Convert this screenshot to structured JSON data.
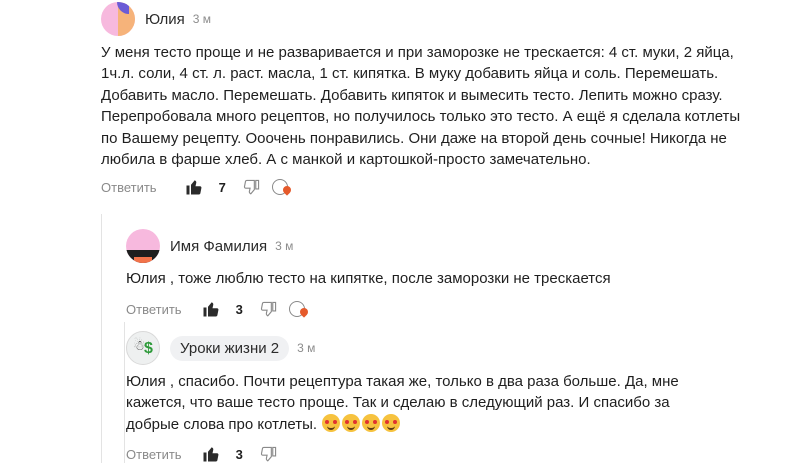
{
  "comments": [
    {
      "author": "Юлия",
      "time": "3 м",
      "text": "У меня тесто проще и не разваривается и при заморозке не трескается: 4 ст. муки, 2 яйца, 1ч.л. соли, 4 ст. л. раст. масла, 1 ст. кипятка. В муку добавить яйца и соль. Перемешать. Добавить масло. Перемешать. Добавить кипяток и вымесить тесто. Лепить можно сразу. Перепробовала много рецептов, но получилось только это тесто. А ещё я сделала котлеты по Вашему рецепту. Ооочень понравились. Они даже на второй день сочные! Никогда не любила в фарше хлеб. А с манкой и картошкой-просто замечательно.",
      "reply_label": "Ответить",
      "likes": "7"
    },
    {
      "author": "Имя Фамилия",
      "time": "3 м",
      "text": "Юлия , тоже люблю тесто на кипятке, после заморозки не трескается",
      "reply_label": "Ответить",
      "likes": "3"
    },
    {
      "author": "Уроки жизни 2",
      "time": "3 м",
      "text": "Юлия , спасибо. Почти рецептура такая же, только в два раза больше. Да, мне кажется, что ваше тесто проще. Так и сделаю в следующий раз. И спасибо за добрые слова про котлеты.",
      "emoji_count": 4,
      "reply_label": "Ответить",
      "likes": "3"
    }
  ],
  "colors": {
    "muted": "#8a8a8a",
    "thread_line": "#e3e3e3",
    "chip_bg": "#f0f1f3"
  }
}
